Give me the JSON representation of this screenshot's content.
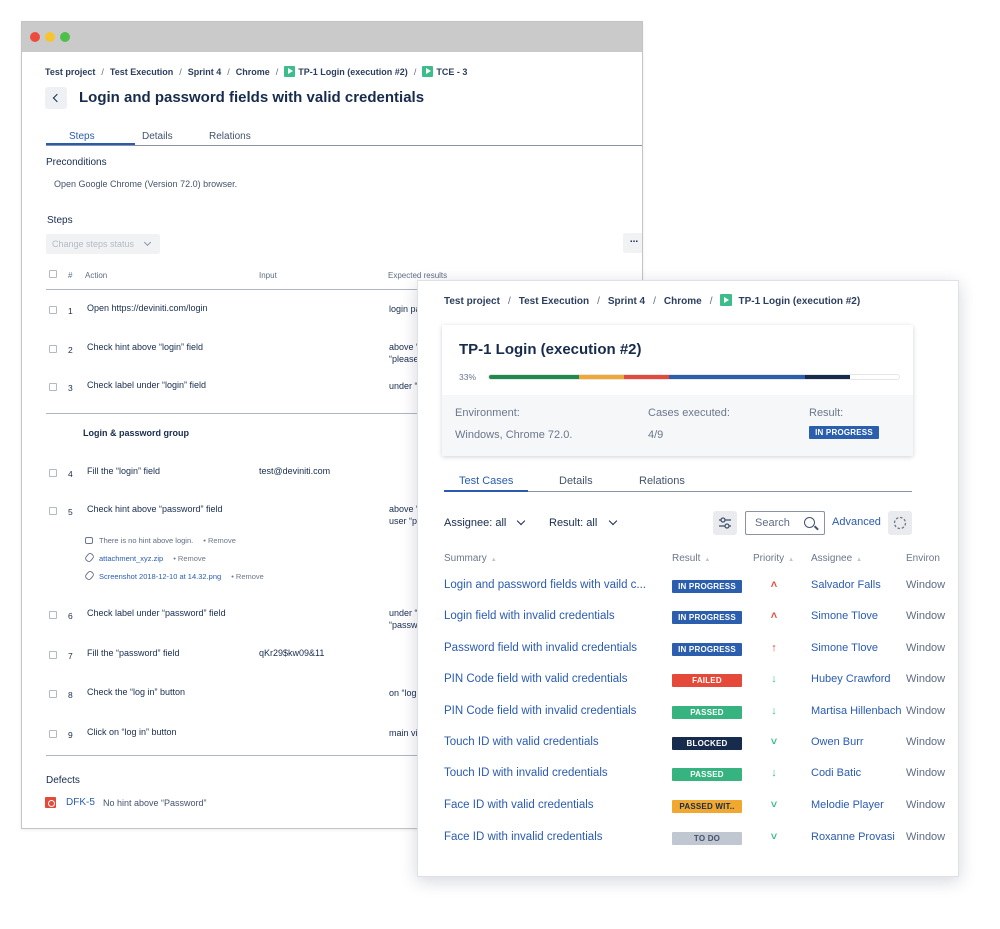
{
  "back_window": {
    "breadcrumbs": [
      "Test project",
      "Test Execution",
      "Sprint 4",
      "Chrome",
      "TP-1 Login (execution #2)",
      "TCE - 3"
    ],
    "title": "Login and password fields with valid credentials",
    "tabs": [
      "Steps",
      "Details",
      "Relations"
    ],
    "preconditions_label": "Preconditions",
    "preconditions_text": "Open Google Chrome (Version 72.0) browser.",
    "steps_label": "Steps",
    "change_status_placeholder": "Change steps status",
    "more_label": "...",
    "headers": {
      "num": "#",
      "action": "Action",
      "input": "Input",
      "expected": "Expected results"
    },
    "steps_a": [
      {
        "num": "1",
        "action": "Open https://deviniti.com/login",
        "input": "",
        "expected": "login pa"
      },
      {
        "num": "2",
        "action": "Check hint above “login” field",
        "input": "",
        "expected": "above “\n“please"
      },
      {
        "num": "3",
        "action": "Check label under “login” field",
        "input": "",
        "expected": "under “"
      }
    ],
    "group_label": "Login & password group",
    "steps_b": [
      {
        "num": "4",
        "action": "Fill the “login” field",
        "input": "test@deviniti.com",
        "expected": ""
      },
      {
        "num": "5",
        "action": "Check hint above “password” field",
        "input": "",
        "expected": "above “\nuser “pl"
      }
    ],
    "notes": [
      {
        "text": "There is no hint above login.",
        "remove": "•  Remove"
      },
      {
        "text": "attachment_xyz.zip",
        "remove": "•  Remove"
      },
      {
        "text": "Screenshot 2018-12-10 at 14.32.png",
        "remove": "•  Remove"
      }
    ],
    "steps_c": [
      {
        "num": "6",
        "action": "Check label under “password” field",
        "input": "",
        "expected": "under “\n“passw"
      },
      {
        "num": "7",
        "action": "Fill the “password” field",
        "input": "qKr29$kw09&11",
        "expected": ""
      },
      {
        "num": "8",
        "action": "Check the “log in” button",
        "input": "",
        "expected": "on “log"
      },
      {
        "num": "9",
        "action": "Click on “log in” button",
        "input": "",
        "expected": "main vi"
      }
    ],
    "defects_label": "Defects",
    "defect": {
      "key": "DFK-5",
      "summary": "No hint above “Password”"
    }
  },
  "front_window": {
    "breadcrumbs": [
      "Test project",
      "Test Execution",
      "Sprint 4",
      "Chrome",
      "TP-1 Login (execution #2)"
    ],
    "card": {
      "title": "TP-1 Login (execution #2)",
      "progress_label": "33%",
      "progress_segments": [
        {
          "color": "#1f8a4c",
          "fraction": 0.22
        },
        {
          "color": "#f0a830",
          "fraction": 0.11
        },
        {
          "color": "#e5493a",
          "fraction": 0.11
        },
        {
          "color": "#2b5fad",
          "fraction": 0.33
        },
        {
          "color": "#172b4d",
          "fraction": 0.11
        },
        {
          "color": "#ffffff",
          "fraction": 0.12
        }
      ],
      "env_label": "Environment:",
      "env_value": "Windows, Chrome 72.0.",
      "cases_label": "Cases executed:",
      "cases_value": "4/9",
      "result_label": "Result:",
      "result_value": "IN PROGRESS"
    },
    "tabs": [
      "Test Cases",
      "Details",
      "Relations"
    ],
    "filters": {
      "assignee": "Assignee: all",
      "result": "Result: all"
    },
    "search_placeholder": "Search",
    "advanced_label": "Advanced",
    "columns": [
      "Summary",
      "Result",
      "Priority",
      "Assignee",
      "Environ"
    ],
    "rows": [
      {
        "summary": "Login and password fields with vaild c...",
        "result": "IN PROGRESS",
        "result_color": "#2b5fad",
        "priority_icon": "˄",
        "priority_name": "highest-priority-icon",
        "priority_color": "#e5493a",
        "assignee": "Salvador Falls",
        "env": "Window"
      },
      {
        "summary": "Login field with invalid credentials",
        "result": "IN PROGRESS",
        "result_color": "#2b5fad",
        "priority_icon": "˄",
        "priority_name": "highest-priority-icon",
        "priority_color": "#e5493a",
        "assignee": "Simone Tlove",
        "env": "Window"
      },
      {
        "summary": "Password field with invalid credentials",
        "result": "IN PROGRESS",
        "result_color": "#2b5fad",
        "priority_icon": "↑",
        "priority_name": "high-priority-icon",
        "priority_color": "#e5493a",
        "assignee": "Simone Tlove",
        "env": "Window"
      },
      {
        "summary": "PIN Code field with valid credentials",
        "result": "FAILED",
        "result_color": "#e5493a",
        "priority_icon": "↓",
        "priority_name": "low-priority-icon",
        "priority_color": "#3dbd8c",
        "assignee": "Hubey Crawford",
        "env": "Window"
      },
      {
        "summary": "PIN Code field with invalid credentials",
        "result": "PASSED",
        "result_color": "#36b37e",
        "priority_icon": "↓",
        "priority_name": "low-priority-icon",
        "priority_color": "#3dbd8c",
        "assignee": "Martisa Hillenbach",
        "env": "Window"
      },
      {
        "summary": "Touch ID with valid credentials",
        "result": "BLOCKED",
        "result_color": "#172b4d",
        "priority_icon": "˅",
        "priority_name": "lowest-priority-icon",
        "priority_color": "#3dbd8c",
        "assignee": "Owen Burr",
        "env": "Window"
      },
      {
        "summary": "Touch ID with invalid credentials",
        "result": "PASSED",
        "result_color": "#36b37e",
        "priority_icon": "↓",
        "priority_name": "low-priority-icon",
        "priority_color": "#3dbd8c",
        "assignee": "Codi Batic",
        "env": "Window"
      },
      {
        "summary": "Face ID with valid credentials",
        "result": "PASSED WIT..",
        "result_color": "#f0a830",
        "priority_icon": "˅",
        "priority_name": "lowest-priority-icon",
        "priority_color": "#3dbd8c",
        "assignee": "Melodie Player",
        "env": "Window"
      },
      {
        "summary": "Face ID with invalid credentials",
        "result": "TO DO",
        "result_color": "#c1c7d0",
        "priority_icon": "˅",
        "priority_name": "lowest-priority-icon",
        "priority_color": "#3dbd8c",
        "assignee": "Roxanne Provasi",
        "env": "Window"
      }
    ]
  }
}
